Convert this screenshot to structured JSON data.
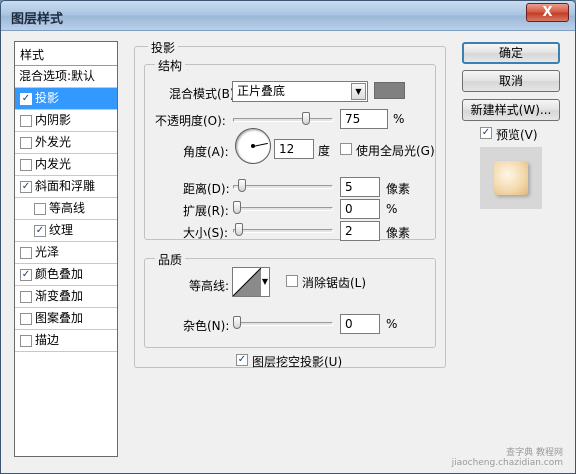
{
  "window": {
    "title": "图层样式",
    "close_label": "X"
  },
  "style_list": {
    "header": "样式",
    "items": [
      {
        "label": "混合选项:默认",
        "has_checkbox": false,
        "checked": false,
        "selected": false,
        "indent": 0
      },
      {
        "label": "投影",
        "has_checkbox": true,
        "checked": true,
        "selected": true,
        "indent": 0
      },
      {
        "label": "内阴影",
        "has_checkbox": true,
        "checked": false,
        "selected": false,
        "indent": 0
      },
      {
        "label": "外发光",
        "has_checkbox": true,
        "checked": false,
        "selected": false,
        "indent": 0
      },
      {
        "label": "内发光",
        "has_checkbox": true,
        "checked": false,
        "selected": false,
        "indent": 0
      },
      {
        "label": "斜面和浮雕",
        "has_checkbox": true,
        "checked": true,
        "selected": false,
        "indent": 0
      },
      {
        "label": "等高线",
        "has_checkbox": true,
        "checked": false,
        "selected": false,
        "indent": 1
      },
      {
        "label": "纹理",
        "has_checkbox": true,
        "checked": true,
        "selected": false,
        "indent": 1
      },
      {
        "label": "光泽",
        "has_checkbox": true,
        "checked": false,
        "selected": false,
        "indent": 0
      },
      {
        "label": "颜色叠加",
        "has_checkbox": true,
        "checked": true,
        "selected": false,
        "indent": 0
      },
      {
        "label": "渐变叠加",
        "has_checkbox": true,
        "checked": false,
        "selected": false,
        "indent": 0
      },
      {
        "label": "图案叠加",
        "has_checkbox": true,
        "checked": false,
        "selected": false,
        "indent": 0
      },
      {
        "label": "描边",
        "has_checkbox": true,
        "checked": false,
        "selected": false,
        "indent": 0
      }
    ]
  },
  "drop_shadow": {
    "title": "投影",
    "structure": {
      "title": "结构",
      "blend_mode": {
        "label": "混合模式(B):",
        "value": "正片叠底",
        "color": "#808080"
      },
      "opacity": {
        "label": "不透明度(O):",
        "value": "75",
        "unit": "%",
        "level": 0.75
      },
      "angle": {
        "label": "角度(A):",
        "value": "12",
        "unit": "度",
        "global_light_label": "使用全局光(G)",
        "global_light_checked": false
      },
      "distance": {
        "label": "距离(D):",
        "value": "5",
        "unit": "像素",
        "level": 0.05
      },
      "spread": {
        "label": "扩展(R):",
        "value": "0",
        "unit": "%",
        "level": 0.0
      },
      "size": {
        "label": "大小(S):",
        "value": "2",
        "unit": "像素",
        "level": 0.02
      }
    },
    "quality": {
      "title": "品质",
      "contour": {
        "label": "等高线:",
        "anti_alias_label": "消除锯齿(L)",
        "anti_alias_checked": false
      },
      "noise": {
        "label": "杂色(N):",
        "value": "0",
        "unit": "%",
        "level": 0.0
      }
    },
    "knockout": {
      "label": "图层挖空投影(U)",
      "checked": true
    }
  },
  "buttons": {
    "ok": "确定",
    "cancel": "取消",
    "new_style": "新建样式(W)...",
    "preview_label": "预览(V)",
    "preview_checked": true
  },
  "watermark": {
    "line1": "查字典 教程网",
    "line2": "jiaocheng.chazidian.com"
  }
}
